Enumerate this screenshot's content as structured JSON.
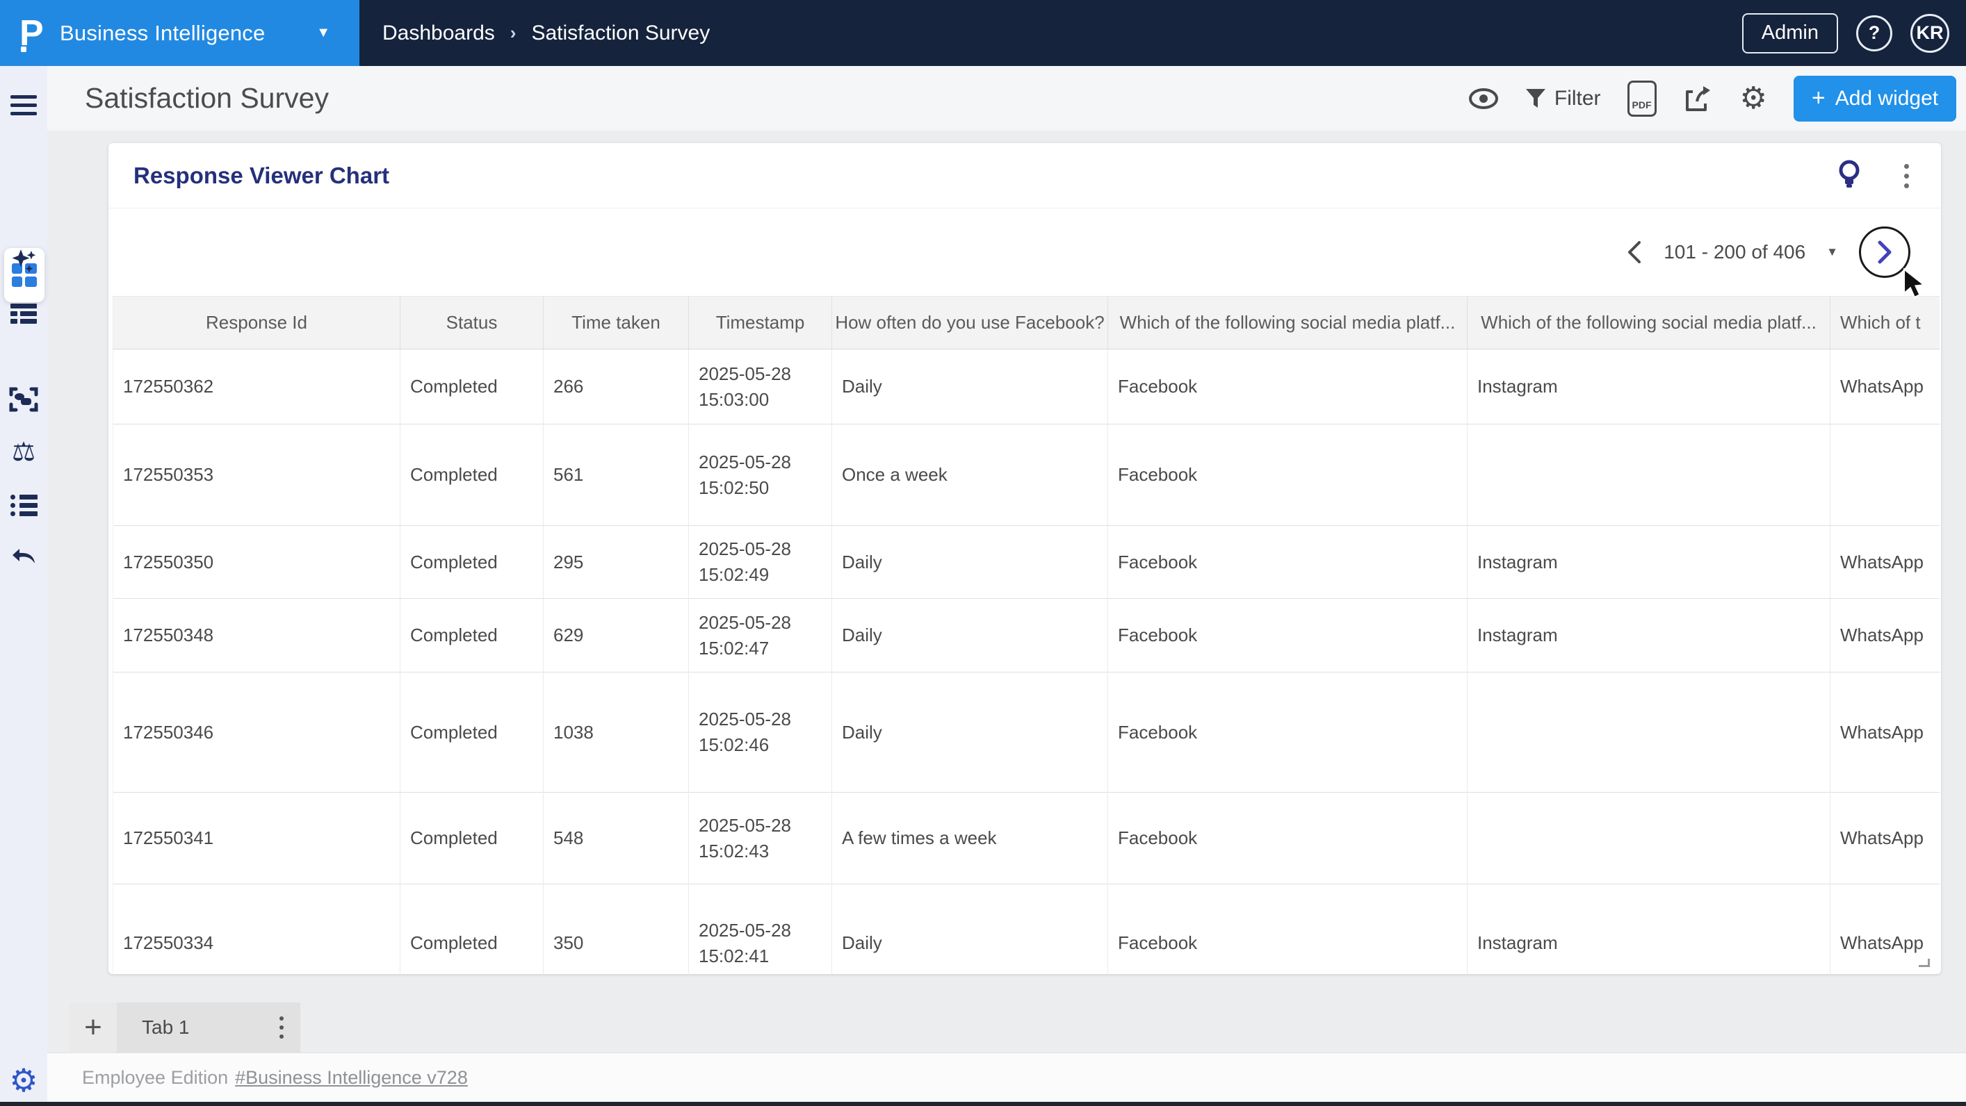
{
  "colors": {
    "brand_blue": "#2289E2",
    "topbar_navy": "#15233C",
    "accent_blue": "#2191E9",
    "sidebar_bg": "#EDEFF8",
    "icon_navy": "#1D2C55",
    "active_icon_blue": "#2B7DE0",
    "widget_title_navy": "#25307C",
    "next_chevron_indigo": "#4342BD",
    "settings_gear_blue": "#2F55C9"
  },
  "topbar": {
    "logo_text": "P",
    "product_name": "Business Intelligence",
    "breadcrumbs": [
      "Dashboards",
      "Satisfaction Survey"
    ],
    "breadcrumb_separator": "›",
    "admin_label": "Admin",
    "help_label": "?",
    "avatar_initials": "KR"
  },
  "toolbar": {
    "page_title": "Satisfaction Survey",
    "filter_label": "Filter",
    "pdf_icon_label": "PDF",
    "add_widget_plus": "+",
    "add_widget_label": "Add widget"
  },
  "sidebar": {
    "icons": [
      "menu",
      "dashboards",
      "ai-sparkles",
      "report-rows",
      "capture",
      "compare-scale",
      "bullet-list",
      "undo",
      "settings-gear"
    ]
  },
  "widget": {
    "title": "Response Viewer Chart",
    "header_icons": [
      "insights-bulb",
      "kebab-menu"
    ],
    "pagination": {
      "range_label": "101 - 200 of 406",
      "prev_icon": "chevron-left",
      "dropdown_icon": "caret-down",
      "next_icon": "chevron-right"
    },
    "table": {
      "columns": [
        "Response Id",
        "Status",
        "Time taken",
        "Timestamp",
        "How often do you use Facebook?",
        "Which of the following social media platf...",
        "Which of the following social media platf...",
        "Which of t"
      ],
      "rows": [
        [
          "172550362",
          "Completed",
          "266",
          "2025-05-28 15:03:00",
          "Daily",
          "Facebook",
          "Instagram",
          "WhatsApp"
        ],
        [
          "172550353",
          "Completed",
          "561",
          "2025-05-28 15:02:50",
          "Once a week",
          "Facebook",
          "",
          ""
        ],
        [
          "172550350",
          "Completed",
          "295",
          "2025-05-28 15:02:49",
          "Daily",
          "Facebook",
          "Instagram",
          "WhatsApp"
        ],
        [
          "172550348",
          "Completed",
          "629",
          "2025-05-28 15:02:47",
          "Daily",
          "Facebook",
          "Instagram",
          "WhatsApp"
        ],
        [
          "172550346",
          "Completed",
          "1038",
          "2025-05-28 15:02:46",
          "Daily",
          "Facebook",
          "",
          "WhatsApp"
        ],
        [
          "172550341",
          "Completed",
          "548",
          "2025-05-28 15:02:43",
          "A few times a week",
          "Facebook",
          "",
          "WhatsApp"
        ],
        [
          "172550334",
          "Completed",
          "350",
          "2025-05-28 15:02:41",
          "Daily",
          "Facebook",
          "Instagram",
          "WhatsApp"
        ]
      ]
    }
  },
  "tabbar": {
    "add_tab_label": "+",
    "tabs": [
      {
        "label": "Tab 1"
      }
    ]
  },
  "footer": {
    "edition_text": "Employee Edition",
    "version_link": "#Business Intelligence v728"
  }
}
